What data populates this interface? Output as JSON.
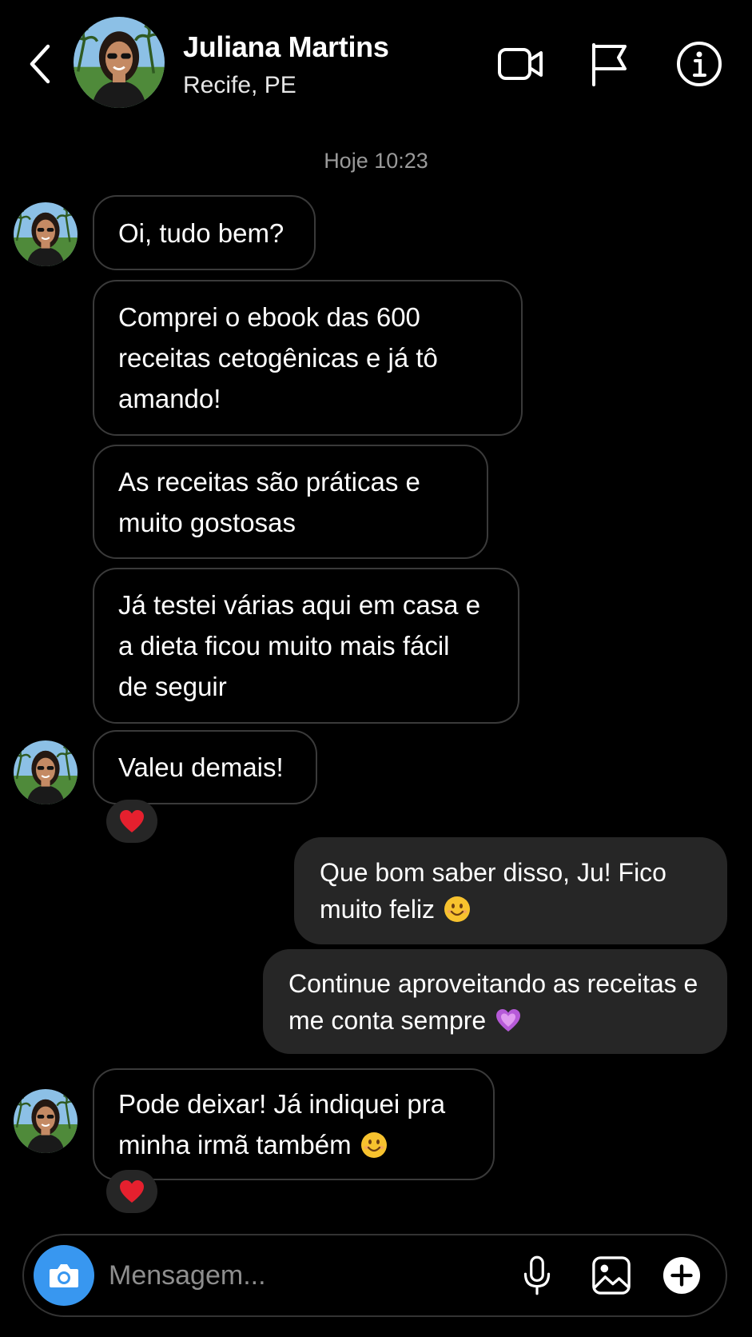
{
  "contact": {
    "name": "Juliana Martins",
    "location": "Recife, PE"
  },
  "conversation": {
    "timestamp": "Hoje 10:23",
    "incoming_group_1": [
      "Oi, tudo bem?",
      "Comprei o ebook das 600 receitas cetogênicas e já tô amando!",
      "As receitas são práticas e muito gostosas",
      "Já testei várias aqui em casa e a dieta ficou muito mais fácil de seguir"
    ],
    "incoming_group_2": {
      "text": "Valeu demais!",
      "reaction": "heart-red"
    },
    "outgoing": [
      {
        "text": "Que bom saber disso, Ju! Fico muito feliz",
        "emoji": "smiling-face"
      },
      {
        "text": "Continue aproveitando as receitas e me conta sempre",
        "emoji": "purple-heart"
      }
    ],
    "incoming_group_3": {
      "text": "Pode deixar! Já indiquei pra minha irmã também",
      "emoji": "smiling-face",
      "reaction": "heart-red"
    }
  },
  "composer": {
    "placeholder": "Mensagem..."
  },
  "icons": [
    "back-chevron-icon",
    "video-call-icon",
    "flag-icon",
    "info-icon",
    "camera-icon",
    "microphone-icon",
    "gallery-icon",
    "plus-icon"
  ],
  "colors": {
    "background": "#000000",
    "outgoing_bubble": "#262626",
    "incoming_border": "#3a3a3a",
    "camera_button": "#3897f0",
    "reaction_heart": "#e5202e",
    "timestamp": "#9a9a9a"
  }
}
